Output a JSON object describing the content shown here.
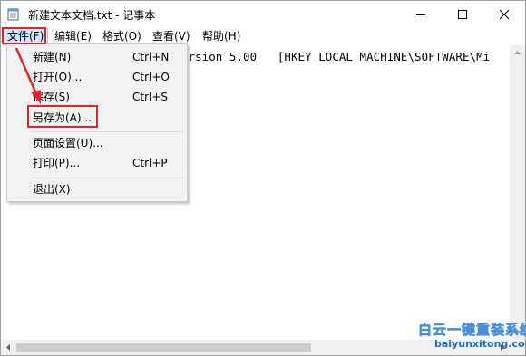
{
  "window": {
    "title": "新建文本文档.txt - 记事本",
    "icon": "notepad-icon",
    "caption_buttons": [
      "minimize-icon",
      "maximize-icon",
      "close-icon"
    ]
  },
  "menubar": {
    "items": [
      {
        "label": "文件(F)"
      },
      {
        "label": "编辑(E)"
      },
      {
        "label": "格式(O)"
      },
      {
        "label": "查看(V)"
      },
      {
        "label": "帮助(H)"
      }
    ],
    "active_index": 0
  },
  "file_menu": {
    "items": [
      {
        "label": "新建(N)",
        "shortcut": "Ctrl+N"
      },
      {
        "label": "打开(O)...",
        "shortcut": "Ctrl+O"
      },
      {
        "label": "保存(S)",
        "shortcut": "Ctrl+S"
      },
      {
        "label": "另存为(A)...",
        "shortcut": ""
      },
      {
        "label": "页面设置(U)...",
        "shortcut": ""
      },
      {
        "label": "打印(P)...",
        "shortcut": "Ctrl+P"
      },
      {
        "label": "退出(X)",
        "shortcut": ""
      }
    ],
    "highlighted_item": "另存为(A)..."
  },
  "editor": {
    "visible_text": "ersion 5.00   [HKEY_LOCAL_MACHINE\\SOFTWARE\\Mi"
  },
  "annotations": {
    "highlight_color": "#e0242b",
    "arrow_color": "#e0242b"
  },
  "watermark": {
    "text_cn": "白云一键重装系统",
    "url": "baiyunxitong.com"
  }
}
